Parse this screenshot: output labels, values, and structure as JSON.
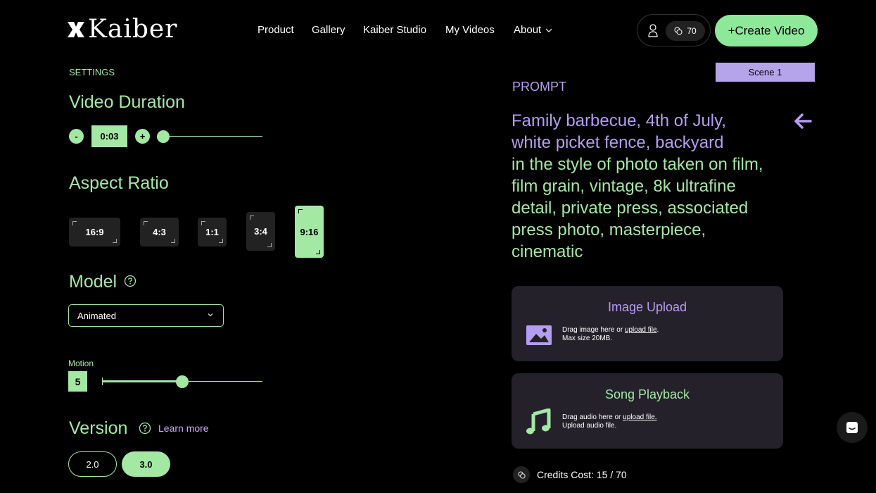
{
  "header": {
    "logo_text": "Kaiber",
    "nav": [
      "Product",
      "Gallery",
      "Kaiber Studio",
      "My Videos",
      "About"
    ],
    "credits": "70",
    "create_label": "+Create Video"
  },
  "settings": {
    "section_label": "SETTINGS",
    "duration": {
      "title": "Video Duration",
      "minus": "-",
      "plus": "+",
      "value": "0:03",
      "slider_fraction": 0.0
    },
    "aspect_ratio": {
      "title": "Aspect Ratio",
      "options": [
        "16:9",
        "4:3",
        "1:1",
        "3:4",
        "9:16"
      ],
      "selected": "9:16"
    },
    "model": {
      "title": "Model",
      "selected": "Animated"
    },
    "motion": {
      "label": "Motion",
      "value": "5",
      "slider_fraction": 0.5
    },
    "version": {
      "title": "Version",
      "learn_more": "Learn more",
      "options": [
        "2.0",
        "3.0"
      ],
      "selected": "3.0"
    }
  },
  "prompt": {
    "scene_label": "Scene 1",
    "label": "PROMPT",
    "subject_lines": [
      "Family barbecue, 4th of July,",
      "white picket fence, backyard"
    ],
    "style_lines": [
      "in the style of photo taken on film,",
      "film grain, vintage, 8k ultrafine",
      "detail, private press, associated",
      "press photo, masterpiece,",
      "cinematic"
    ]
  },
  "image_upload": {
    "title": "Image Upload",
    "line1_prefix": "Drag image here or ",
    "line1_link": "upload file",
    "line1_suffix": ".",
    "line2": "Max size 20MB."
  },
  "song_playback": {
    "title": "Song Playback",
    "line1_prefix": "Drag audio here or ",
    "line1_link": "upload file.",
    "line2": "Upload audio file."
  },
  "credits_cost": "Credits Cost: 15 / 70",
  "colors": {
    "accent_green": "#a3e8a3",
    "accent_purple": "#b59df0",
    "button_green": "#8ee89a"
  }
}
